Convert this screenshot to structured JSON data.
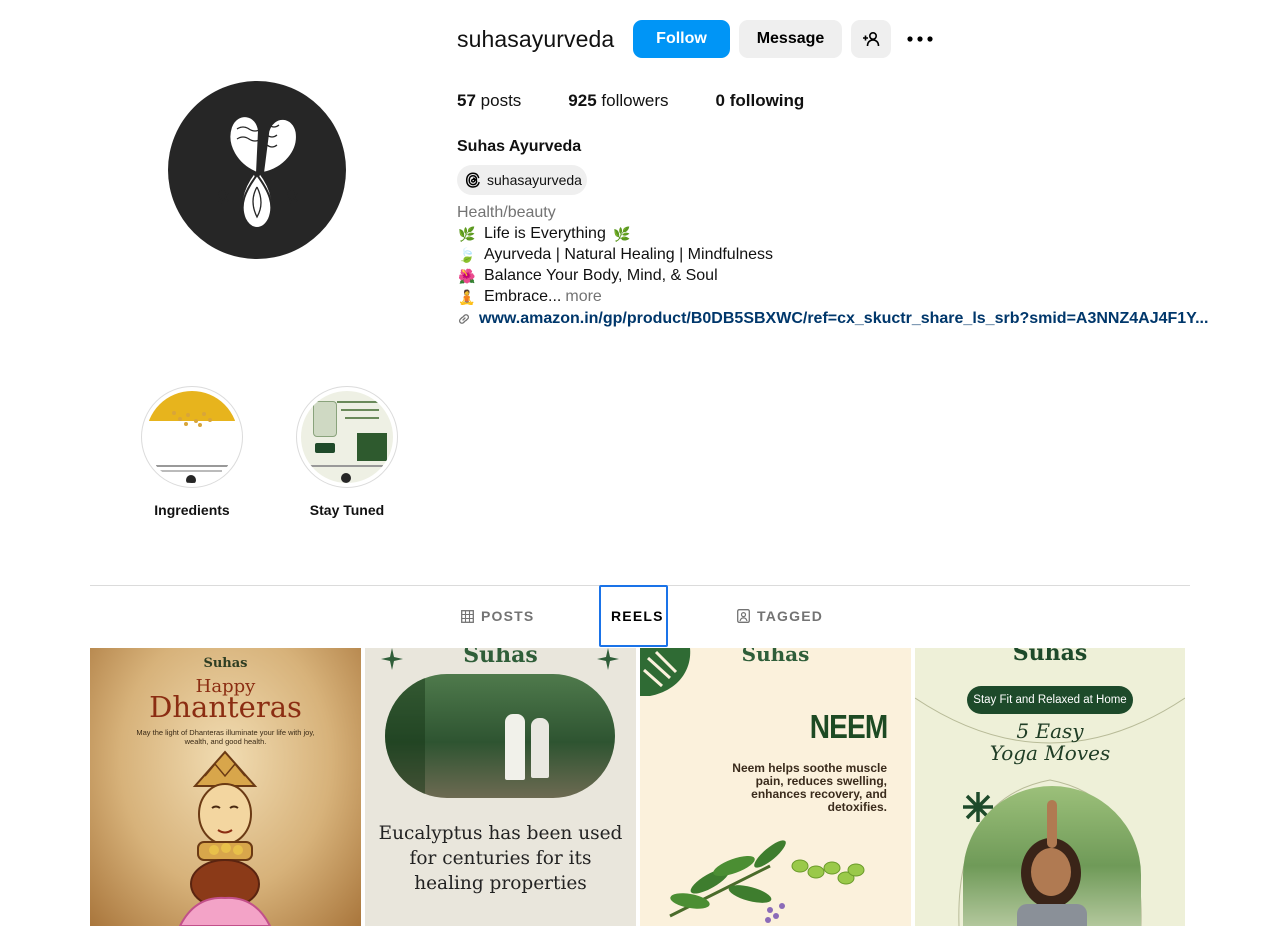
{
  "profile": {
    "username": "suhasayurveda",
    "full_name": "Suhas Ayurveda",
    "threads_handle": "suhasayurveda",
    "category": "Health/beauty",
    "bio_lines": [
      {
        "emoji": "🌿",
        "text": "Life is Everything",
        "emoji_after": "🌿"
      },
      {
        "emoji": "🍃",
        "text": "Ayurveda | Natural Healing | Mindfulness"
      },
      {
        "emoji": "🌺",
        "text": "Balance Your Body, Mind, & Soul"
      },
      {
        "emoji": "🧘",
        "text": "Embrace..."
      }
    ],
    "more_label": "more",
    "link": "www.amazon.in/gp/product/B0DB5SBXWC/ref=cx_skuctr_share_ls_srb?smid=A3NNZ4AJ4F1Y..."
  },
  "actions": {
    "follow_label": "Follow",
    "message_label": "Message",
    "suggest_icon": "add-person-icon",
    "more_icon": "more-options-icon"
  },
  "stats": {
    "posts_count": "57",
    "posts_label": "posts",
    "followers_count": "925",
    "followers_label": "followers",
    "following_count": "0",
    "following_label": "following"
  },
  "highlights": [
    {
      "label": "Ingredients"
    },
    {
      "label": "Stay Tuned"
    }
  ],
  "tabs": [
    {
      "label": "POSTS",
      "icon": "grid-icon",
      "active": false
    },
    {
      "label": "REELS",
      "icon": "reels-icon",
      "active": true
    },
    {
      "label": "TAGGED",
      "icon": "tagged-icon",
      "active": false
    }
  ],
  "grid": [
    {
      "brand": "Suhas",
      "subtitle": "Happy",
      "title": "Dhanteras",
      "text": "May the light of Dhanteras illuminate your life with joy, wealth, and good health."
    },
    {
      "brand": "Suhas",
      "caption": "Eucalyptus has been used for centuries for its healing properties"
    },
    {
      "brand": "Suhas",
      "title": "NEEM",
      "text": "Neem helps soothe muscle pain, reduces swelling, enhances recovery, and detoxifies."
    },
    {
      "brand": "Suhas",
      "pill": "Stay Fit and Relaxed at Home",
      "title_line1": "5 Easy",
      "title_line2": "Yoga Moves"
    }
  ],
  "colors": {
    "follow_blue": "#0095f6",
    "link_blue": "#00376b",
    "secondary_gray": "#efefef",
    "muted_text": "#737373",
    "active_tab_outline": "#1a73e8"
  }
}
